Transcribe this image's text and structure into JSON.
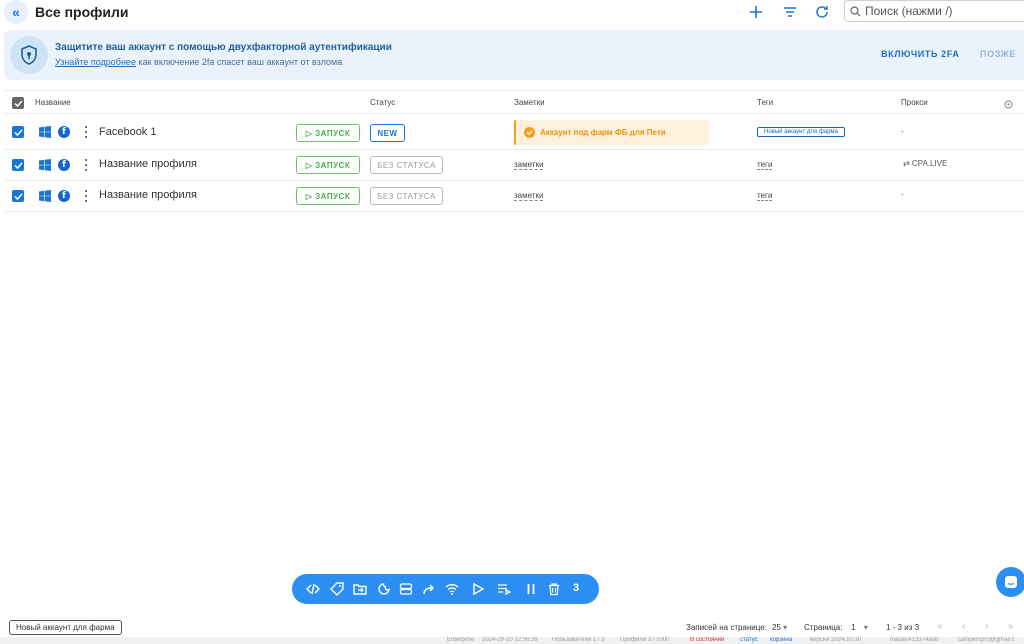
{
  "header": {
    "title": "Все профили",
    "search_placeholder": "Поиск (нажми /)"
  },
  "banner": {
    "title": "Защитите ваш аккаунт с помощью двухфакторной аутентификации",
    "link_text": "Узнайте подробнее",
    "sub_text": " как включение 2fa спасет ваш аккаунт от взлома",
    "enable_label": "ВКЛЮЧИТЬ 2FA",
    "later_label": "ПОЗЖЕ"
  },
  "table": {
    "columns": {
      "name": "Название",
      "status": "Статус",
      "notes": "Заметки",
      "tags": "Теги",
      "proxy": "Прокси"
    },
    "rows": [
      {
        "name": "Facebook 1",
        "run": "▷ ЗАПУСК",
        "status": "NEW",
        "note": "Аккаунт под фарм ФБ для Пети",
        "tag": "Новый аккаунт для фарма",
        "proxy": "-"
      },
      {
        "name": "Название профиля",
        "run": "▷ ЗАПУСК",
        "status": "БЕЗ СТАТУСА",
        "note": "заметки",
        "tag": "теги",
        "proxy": "⇄ CPA.LIVE"
      },
      {
        "name": "Название профиля",
        "run": "▷ ЗАПУСК",
        "status": "БЕЗ СТАТУСА",
        "note": "заметки",
        "tag": "теги",
        "proxy": "-"
      }
    ]
  },
  "action_bar": {
    "icons": [
      "code-icon",
      "tag-icon",
      "folder-move-icon",
      "cookie-icon",
      "storage-icon",
      "share-icon",
      "wifi-icon",
      "play-icon",
      "queue-icon",
      "pause-icon",
      "trash-icon"
    ],
    "selected_count": "3"
  },
  "footer": {
    "tag_label": "Новый аккаунт для фарма",
    "per_page_label": "Записей на странице:",
    "per_page_value": "25",
    "page_label": "Страница:",
    "page_value": "1",
    "range": "1 - 3 из 3"
  },
  "statusbar": {
    "edition": "Enterprise",
    "datetime": "2024-29-10 12:56:39",
    "users": "Пользователи 1 / 3",
    "profiles": "Профили 3 / 1000",
    "state": "В состоянии",
    "status": "статус",
    "trash": "корзина",
    "version": "версия 2024.10.30",
    "branch": "master#13374ae8",
    "email": "camperspro@gmail.c"
  },
  "colors": {
    "accent": "#1976d2",
    "run": "#4caf50",
    "note_bg": "#fdf0dc",
    "note_text": "#e89410"
  }
}
